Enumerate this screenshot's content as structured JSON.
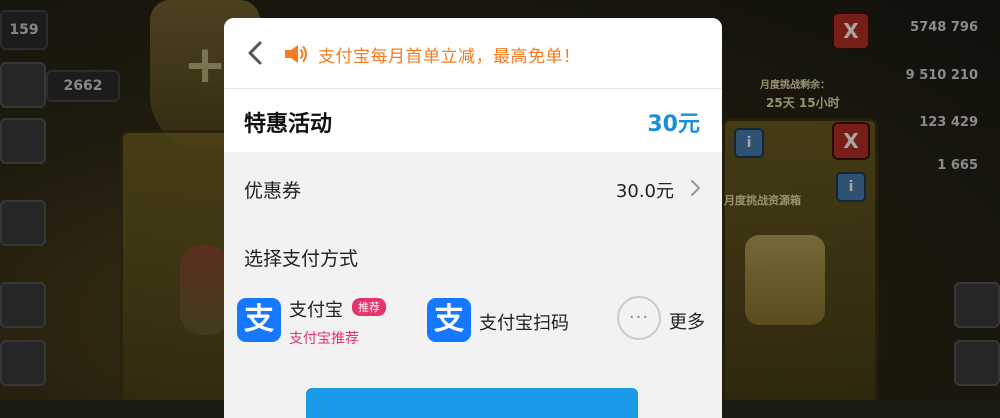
{
  "colors": {
    "promo_orange": "#f57b20",
    "price_blue": "#1a8fd8",
    "alipay_blue": "#1677ff",
    "badge_pink": "#e6336a",
    "confirm_blue": "#1a9ae8"
  },
  "background_game": {
    "top_left_value": "159",
    "left_stat": "2662",
    "stats_right": [
      "5748 796",
      "9 510 210",
      "123 429",
      "1 665"
    ],
    "month_timer_label": "月度挑战剩余：",
    "month_timer_value": "25天 15小时",
    "panel_title_partial": "月度挑战资源箱",
    "close_label": "X",
    "info_label": "i"
  },
  "dialog": {
    "header": {
      "back_icon": "chevron-left-icon",
      "promo_icon": "speaker-icon",
      "promo_text": "支付宝每月首单立减，最高免单！"
    },
    "special": {
      "title": "特惠活动",
      "amount": "30元"
    },
    "coupon": {
      "label": "优惠券",
      "value": "30.0元",
      "chevron_icon": "chevron-right-icon"
    },
    "payment": {
      "heading": "选择支付方式",
      "options": [
        {
          "name": "支付宝",
          "badge": "推荐",
          "subtitle": "支付宝推荐",
          "logo_char": "支",
          "icon": "alipay-icon"
        },
        {
          "name": "支付宝扫码",
          "logo_char": "支",
          "icon": "alipay-icon"
        },
        {
          "name": "更多",
          "more_glyph": "···",
          "icon": "more-icon"
        }
      ]
    }
  }
}
